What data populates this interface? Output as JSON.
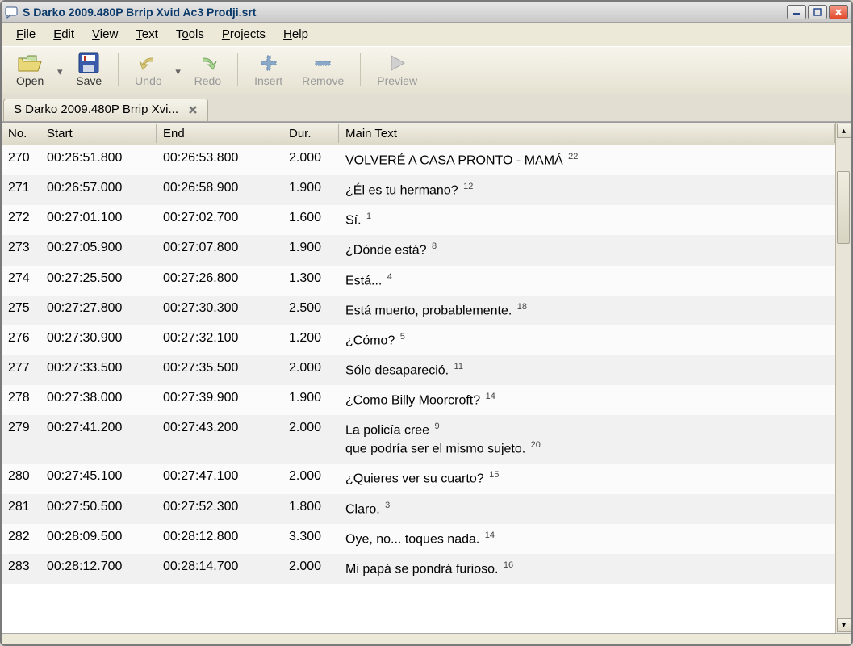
{
  "window": {
    "title": "S Darko 2009.480P Brrip Xvid Ac3 Prodji.srt"
  },
  "menubar": [
    {
      "label": "File",
      "u": "F"
    },
    {
      "label": "Edit",
      "u": "E"
    },
    {
      "label": "View",
      "u": "V"
    },
    {
      "label": "Text",
      "u": "T"
    },
    {
      "label": "Tools",
      "u": "o"
    },
    {
      "label": "Projects",
      "u": "P"
    },
    {
      "label": "Help",
      "u": "H"
    }
  ],
  "toolbar": {
    "open": "Open",
    "save": "Save",
    "undo": "Undo",
    "redo": "Redo",
    "insert": "Insert",
    "remove": "Remove",
    "preview": "Preview"
  },
  "tab": {
    "label": "S Darko 2009.480P Brrip Xvi..."
  },
  "columns": {
    "no": "No.",
    "start": "Start",
    "end": "End",
    "dur": "Dur.",
    "main": "Main Text"
  },
  "rows": [
    {
      "no": 270,
      "start": "00:26:51.800",
      "end": "00:26:53.800",
      "dur": "2.000",
      "lines": [
        {
          "t": "VOLVERÉ A CASA PRONTO - MAMÁ",
          "n": 22
        }
      ]
    },
    {
      "no": 271,
      "start": "00:26:57.000",
      "end": "00:26:58.900",
      "dur": "1.900",
      "lines": [
        {
          "t": "¿Él es tu hermano?",
          "n": 12
        }
      ]
    },
    {
      "no": 272,
      "start": "00:27:01.100",
      "end": "00:27:02.700",
      "dur": "1.600",
      "lines": [
        {
          "t": "Sí.",
          "n": 1
        }
      ]
    },
    {
      "no": 273,
      "start": "00:27:05.900",
      "end": "00:27:07.800",
      "dur": "1.900",
      "lines": [
        {
          "t": "¿Dónde está?",
          "n": 8
        }
      ]
    },
    {
      "no": 274,
      "start": "00:27:25.500",
      "end": "00:27:26.800",
      "dur": "1.300",
      "lines": [
        {
          "t": "Está...",
          "n": 4
        }
      ]
    },
    {
      "no": 275,
      "start": "00:27:27.800",
      "end": "00:27:30.300",
      "dur": "2.500",
      "lines": [
        {
          "t": "Está muerto, probablemente.",
          "n": 18
        }
      ]
    },
    {
      "no": 276,
      "start": "00:27:30.900",
      "end": "00:27:32.100",
      "dur": "1.200",
      "lines": [
        {
          "t": "¿Cómo?",
          "n": 5
        }
      ]
    },
    {
      "no": 277,
      "start": "00:27:33.500",
      "end": "00:27:35.500",
      "dur": "2.000",
      "lines": [
        {
          "t": "Sólo desapareció.",
          "n": 11
        }
      ]
    },
    {
      "no": 278,
      "start": "00:27:38.000",
      "end": "00:27:39.900",
      "dur": "1.900",
      "lines": [
        {
          "t": "¿Como Billy Moorcroft?",
          "n": 14
        }
      ]
    },
    {
      "no": 279,
      "start": "00:27:41.200",
      "end": "00:27:43.200",
      "dur": "2.000",
      "lines": [
        {
          "t": "La policía cree",
          "n": 9
        },
        {
          "t": "que podría ser el mismo sujeto.",
          "n": 20
        }
      ]
    },
    {
      "no": 280,
      "start": "00:27:45.100",
      "end": "00:27:47.100",
      "dur": "2.000",
      "lines": [
        {
          "t": "¿Quieres ver su cuarto?",
          "n": 15
        }
      ]
    },
    {
      "no": 281,
      "start": "00:27:50.500",
      "end": "00:27:52.300",
      "dur": "1.800",
      "lines": [
        {
          "t": "Claro.",
          "n": 3
        }
      ]
    },
    {
      "no": 282,
      "start": "00:28:09.500",
      "end": "00:28:12.800",
      "dur": "3.300",
      "lines": [
        {
          "t": "Oye, no... toques nada.",
          "n": 14
        }
      ]
    },
    {
      "no": 283,
      "start": "00:28:12.700",
      "end": "00:28:14.700",
      "dur": "2.000",
      "lines": [
        {
          "t": "Mi papá se pondrá furioso.",
          "n": 16
        }
      ]
    }
  ]
}
